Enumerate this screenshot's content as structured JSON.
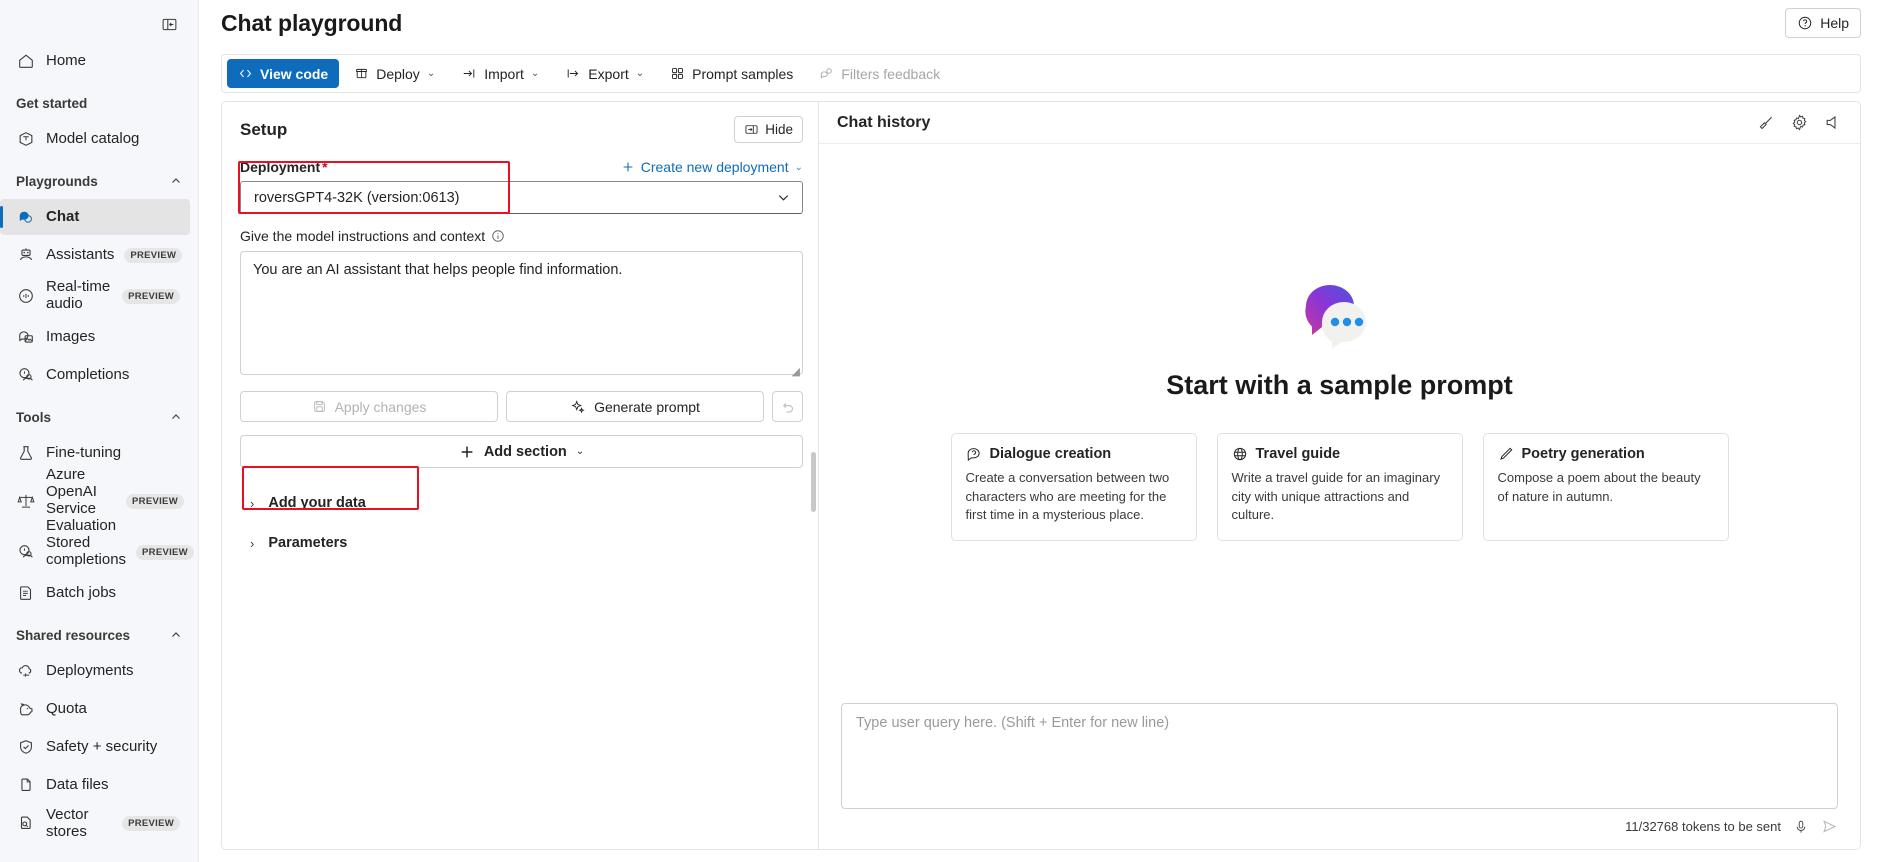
{
  "sidebar": {
    "collapse_icon": "panel-collapse-icon",
    "home": {
      "label": "Home",
      "icon": "home-icon"
    },
    "groups": [
      {
        "label": "Get started",
        "collapsible": false,
        "items": [
          {
            "label": "Model catalog",
            "icon": "model-catalog-icon",
            "preview": ""
          }
        ]
      },
      {
        "label": "Playgrounds",
        "collapsible": true,
        "items": [
          {
            "label": "Chat",
            "icon": "chat-icon",
            "preview": "",
            "selected": true
          },
          {
            "label": "Assistants",
            "icon": "assistants-icon",
            "preview": "PREVIEW"
          },
          {
            "label": "Real-time audio",
            "icon": "realtime-audio-icon",
            "preview": "PREVIEW"
          },
          {
            "label": "Images",
            "icon": "images-icon",
            "preview": ""
          },
          {
            "label": "Completions",
            "icon": "completions-icon",
            "preview": ""
          }
        ]
      },
      {
        "label": "Tools",
        "collapsible": true,
        "items": [
          {
            "label": "Fine-tuning",
            "icon": "fine-tuning-icon",
            "preview": ""
          },
          {
            "label": "Azure OpenAI Service Evaluation",
            "icon": "evaluation-icon",
            "preview": "PREVIEW"
          },
          {
            "label": "Stored completions",
            "icon": "stored-completions-icon",
            "preview": "PREVIEW"
          },
          {
            "label": "Batch jobs",
            "icon": "batch-jobs-icon",
            "preview": ""
          }
        ]
      },
      {
        "label": "Shared resources",
        "collapsible": true,
        "items": [
          {
            "label": "Deployments",
            "icon": "deployments-icon",
            "preview": ""
          },
          {
            "label": "Quota",
            "icon": "quota-icon",
            "preview": ""
          },
          {
            "label": "Safety + security",
            "icon": "safety-security-icon",
            "preview": ""
          },
          {
            "label": "Data files",
            "icon": "data-files-icon",
            "preview": ""
          },
          {
            "label": "Vector stores",
            "icon": "vector-stores-icon",
            "preview": "PREVIEW"
          }
        ]
      }
    ]
  },
  "header": {
    "title": "Chat playground",
    "help_label": "Help",
    "help_icon": "question-circle-icon"
  },
  "toolbar": {
    "view_code": {
      "label": "View code",
      "icon": "code-icon"
    },
    "deploy": {
      "label": "Deploy",
      "icon": "deploy-icon",
      "caret": "⌄"
    },
    "import": {
      "label": "Import",
      "icon": "import-icon",
      "caret": "⌄"
    },
    "export": {
      "label": "Export",
      "icon": "export-icon",
      "caret": "⌄"
    },
    "prompt_samples": {
      "label": "Prompt samples",
      "icon": "grid-icon"
    },
    "filters_feedback": {
      "label": "Filters feedback",
      "icon": "feedback-icon",
      "disabled": true
    }
  },
  "setup": {
    "title": "Setup",
    "hide_label": "Hide",
    "hide_icon": "panel-hide-icon",
    "deployment_label": "Deployment",
    "required_mark": "*",
    "create_deployment_label": "Create new deployment",
    "create_deployment_icon": "plus-icon",
    "create_deployment_caret": "⌄",
    "deployment_value": "roversGPT4-32K (version:0613)",
    "deployment_caret_icon": "chevron-down-icon",
    "system_message_label": "Give the model instructions and context",
    "system_message_info_icon": "info-icon",
    "system_message_value": "You are an AI assistant that helps people find information.",
    "apply_changes_label": "Apply changes",
    "apply_changes_icon": "save-icon",
    "generate_prompt_label": "Generate prompt",
    "generate_prompt_icon": "sparkle-icon",
    "revert_icon": "undo-icon",
    "add_section_label": "Add section",
    "add_section_icon": "plus-icon",
    "add_section_caret": "⌄",
    "add_your_data_label": "Add your data",
    "parameters_label": "Parameters",
    "accordion_chevron": "›",
    "highlight_color": "#e81123"
  },
  "chat": {
    "title": "Chat history",
    "actions": [
      {
        "name": "clear-chat-icon",
        "label": "Clear chat"
      },
      {
        "name": "settings-gear-icon",
        "label": "Settings"
      },
      {
        "name": "speaker-icon",
        "label": "Audio"
      }
    ],
    "empty_state": {
      "logo_icon": "chat-bubbles-logo",
      "title": "Start with a sample prompt",
      "cards": [
        {
          "icon": "dialogue-icon",
          "title": "Dialogue creation",
          "description": "Create a conversation between two characters who are meeting for the first time in a mysterious place."
        },
        {
          "icon": "globe-icon",
          "title": "Travel guide",
          "description": "Write a travel guide for an imaginary city with unique attractions and culture."
        },
        {
          "icon": "pen-icon",
          "title": "Poetry generation",
          "description": "Compose a poem about the beauty of nature in autumn."
        }
      ]
    },
    "input_placeholder": "Type user query here. (Shift + Enter for new line)",
    "input_value": "",
    "token_status": "11/32768 tokens to be sent",
    "mic_icon": "microphone-icon",
    "send_icon": "send-icon"
  },
  "colors": {
    "accent": "#0f6cbd",
    "highlight": "#e81123",
    "sidebar_bg": "#f5f7fa",
    "selected_bg": "#e4e4e4",
    "required": "#c50f1f"
  }
}
